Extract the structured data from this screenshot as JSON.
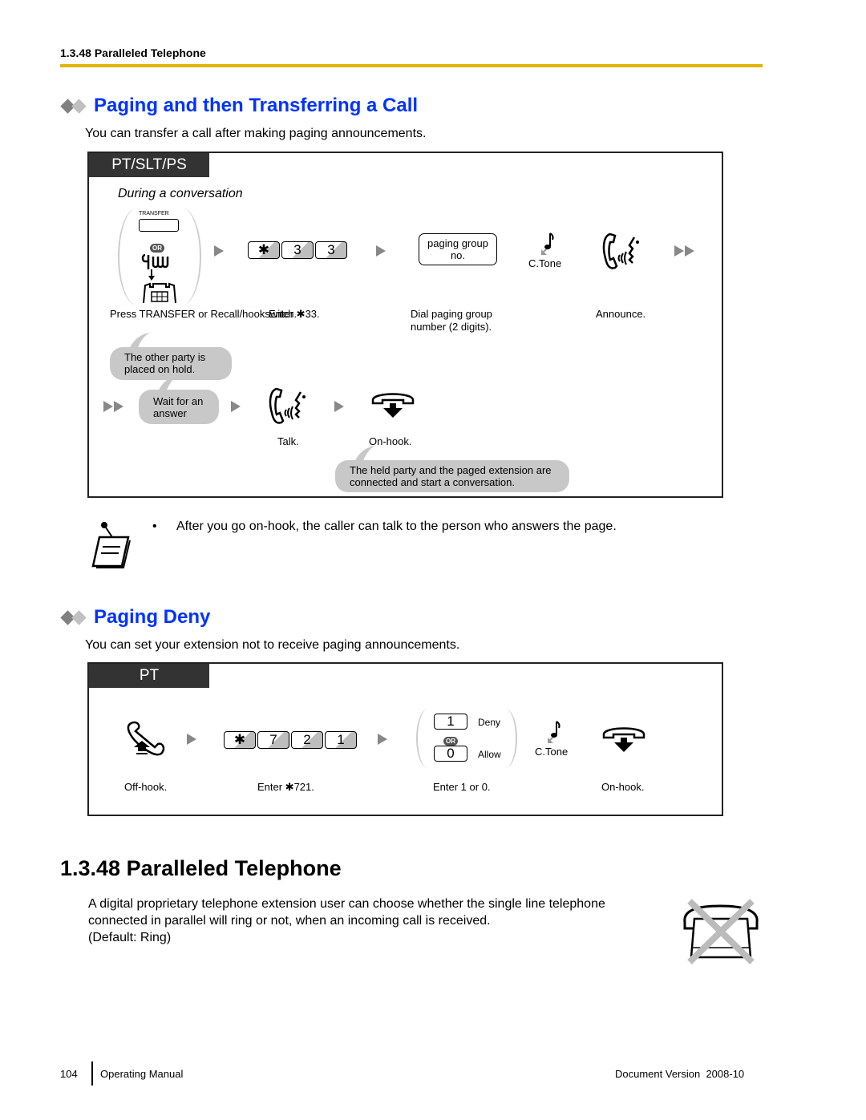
{
  "running_head": "1.3.48 Paralleled Telephone",
  "section1": {
    "title": "Paging and then Transferring a Call",
    "intro": "You can transfer a call after making paging announcements.",
    "frame_label": "PT/SLT/PS",
    "context": "During a conversation",
    "transfer_key_label": "TRANSFER",
    "or_label": "OR",
    "keys": [
      "✱",
      "3",
      "3"
    ],
    "paging_box": "paging group no.",
    "ctone_label": "C.Tone",
    "step_labels": {
      "transfer": "Press TRANSFER or Recall/hookswitch.",
      "enter": "Enter ✱33.",
      "dial": "Dial paging group number (2 digits).",
      "announce": "Announce."
    },
    "bubble_hold": "The other party is placed on hold.",
    "bubble_wait": "Wait for an answer",
    "talk_label": "Talk.",
    "onhook_label": "On-hook.",
    "bubble_connected": "The held party and the paged extension are connected and start a conversation."
  },
  "note": {
    "bullet": "•",
    "text": "After you go on-hook, the caller can talk to the person who answers the page."
  },
  "section2": {
    "title": "Paging Deny",
    "intro": "You can set your extension not to receive paging announcements.",
    "frame_label": "PT",
    "keys": [
      "✱",
      "7",
      "2",
      "1"
    ],
    "option_deny_key": "1",
    "option_deny_label": "Deny",
    "option_allow_key": "0",
    "option_allow_label": "Allow",
    "or_label": "OR",
    "ctone_label": "C.Tone",
    "step_labels": {
      "offhook": "Off-hook.",
      "enter": "Enter ✱721.",
      "choose": "Enter 1 or 0.",
      "onhook": "On-hook."
    }
  },
  "section3": {
    "title": "1.3.48  Paralleled Telephone",
    "body_line1": "A digital proprietary telephone extension user can choose whether the single line telephone",
    "body_line2": "connected in parallel will ring or not, when an incoming call is received.",
    "default": "(Default: Ring)"
  },
  "footer": {
    "page_number": "104",
    "manual": "Operating Manual",
    "version": "Document Version  2008-10"
  },
  "colors": {
    "heading_blue": "#0033ff",
    "rule_gold": "#e0b400",
    "bubble_gray": "#c8c8c8"
  }
}
